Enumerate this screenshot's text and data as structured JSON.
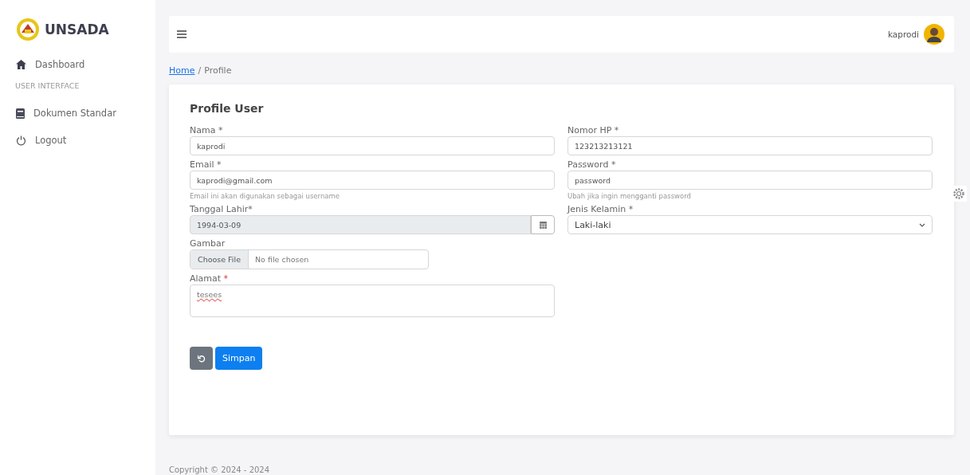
{
  "sidebar": {
    "brand": "UNSADA",
    "items": [
      {
        "kind": "home",
        "label": "Dashboard"
      },
      {
        "kind": "section",
        "label": "USER INTERFACE"
      },
      {
        "kind": "document",
        "label": "Dokumen Standar"
      },
      {
        "kind": "power",
        "label": "Logout"
      }
    ]
  },
  "topbar": {
    "user": "kaprodi"
  },
  "breadcrumb": {
    "separator": "/",
    "items": [
      {
        "label": "Home",
        "link": true
      },
      {
        "label": "Profile",
        "link": false
      }
    ]
  },
  "card": {
    "title": "Profile User",
    "left": [
      {
        "kind": "text",
        "label": "Nama *",
        "value": "kaprodi"
      },
      {
        "kind": "text",
        "label": "Email *",
        "value": "kaprodi@gmail.com",
        "help": "Email ini akan digunakan sebagai username"
      },
      {
        "kind": "date",
        "label": "Tanggal Lahir*",
        "value": "1994-03-09",
        "readonly": true
      },
      {
        "kind": "file",
        "label": "Gambar",
        "button": "Choose File",
        "value": "No file chosen"
      },
      {
        "kind": "textarea",
        "label": "Alamat",
        "mark": "*",
        "value": "tesees"
      }
    ],
    "right": [
      {
        "kind": "text",
        "label": "Nomor HP *",
        "value": "123213213121"
      },
      {
        "kind": "text",
        "label": "Password *",
        "value": "password",
        "help": "Ubah jika ingin mengganti password"
      },
      {
        "kind": "select",
        "label": "Jenis Kelamin *",
        "value": "Laki-laki"
      }
    ],
    "save": "Simpan"
  },
  "footer": "Copyright © 2024 - 2024"
}
